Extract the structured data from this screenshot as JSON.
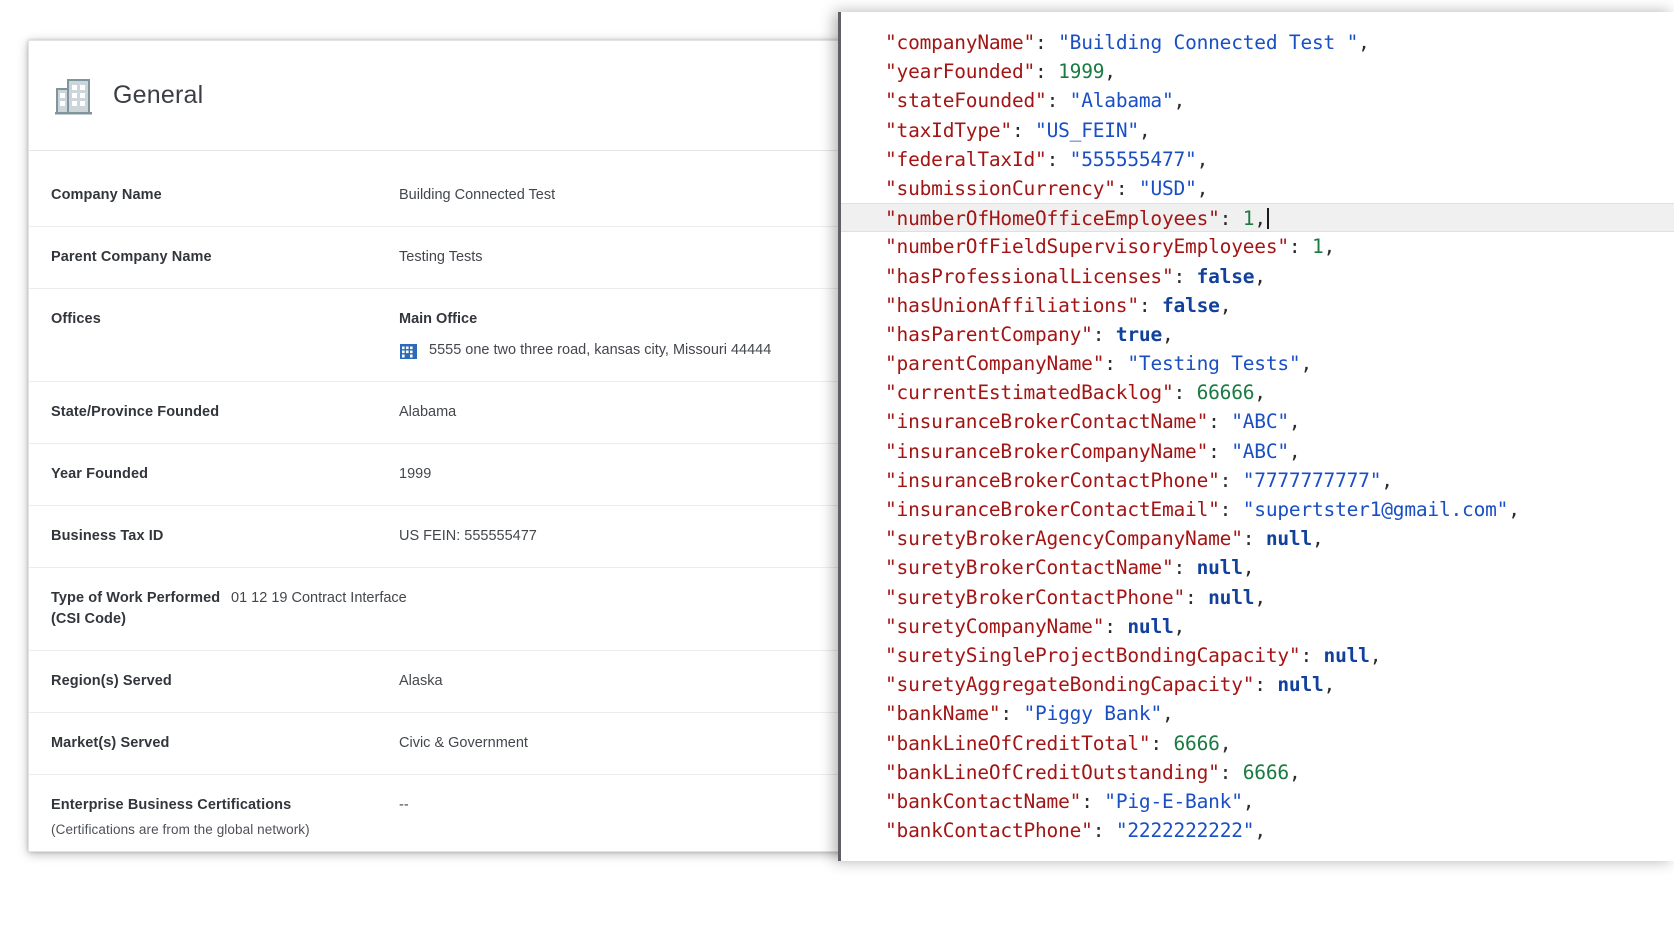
{
  "general_card": {
    "title": "General",
    "icon": "building-icon",
    "rows": [
      {
        "label": "Company Name",
        "sublabel": "",
        "value": "Building Connected Test",
        "type": "text"
      },
      {
        "label": "Parent Company Name",
        "sublabel": "",
        "value": "Testing Tests",
        "type": "text"
      },
      {
        "label": "Offices",
        "sublabel": "",
        "value": "",
        "type": "office",
        "office_name": "Main Office",
        "office_address": "5555 one two three road, kansas city, Missouri 44444",
        "office_icon": "office-building-icon"
      },
      {
        "label": "State/Province Founded",
        "sublabel": "",
        "value": "Alabama",
        "type": "text"
      },
      {
        "label": "Year Founded",
        "sublabel": "",
        "value": "1999",
        "type": "text"
      },
      {
        "label": "Business Tax ID",
        "sublabel": "",
        "value": "US FEIN: 555555477",
        "type": "text"
      },
      {
        "label": "Type of Work Performed (CSI Code)",
        "sublabel": "",
        "value": "01 12 19 Contract Interface",
        "type": "text"
      },
      {
        "label": "Region(s) Served",
        "sublabel": "",
        "value": "Alaska",
        "type": "text"
      },
      {
        "label": "Market(s) Served",
        "sublabel": "",
        "value": "Civic & Government",
        "type": "text"
      },
      {
        "label": "Enterprise Business Certifications",
        "sublabel": "(Certifications are from the global network)",
        "value": "--",
        "type": "text"
      }
    ]
  },
  "json_panel": {
    "active_line_index": 6,
    "lines": [
      {
        "key": "companyName",
        "value": "Building Connected Test ",
        "vtype": "string",
        "trail": ","
      },
      {
        "key": "yearFounded",
        "value": "1999",
        "vtype": "number",
        "trail": ","
      },
      {
        "key": "stateFounded",
        "value": "Alabama",
        "vtype": "string",
        "trail": ","
      },
      {
        "key": "taxIdType",
        "value": "US_FEIN",
        "vtype": "string",
        "trail": ","
      },
      {
        "key": "federalTaxId",
        "value": "555555477",
        "vtype": "string",
        "trail": ","
      },
      {
        "key": "submissionCurrency",
        "value": "USD",
        "vtype": "string",
        "trail": ","
      },
      {
        "key": "numberOfHomeOfficeEmployees",
        "value": "1",
        "vtype": "number",
        "trail": ","
      },
      {
        "key": "numberOfFieldSupervisoryEmployees",
        "value": "1",
        "vtype": "number",
        "trail": ","
      },
      {
        "key": "hasProfessionalLicenses",
        "value": "false",
        "vtype": "literal",
        "trail": ","
      },
      {
        "key": "hasUnionAffiliations",
        "value": "false",
        "vtype": "literal",
        "trail": ","
      },
      {
        "key": "hasParentCompany",
        "value": "true",
        "vtype": "literal",
        "trail": ","
      },
      {
        "key": "parentCompanyName",
        "value": "Testing Tests",
        "vtype": "string",
        "trail": ","
      },
      {
        "key": "currentEstimatedBacklog",
        "value": "66666",
        "vtype": "number",
        "trail": ","
      },
      {
        "key": "insuranceBrokerContactName",
        "value": "ABC",
        "vtype": "string",
        "trail": ","
      },
      {
        "key": "insuranceBrokerCompanyName",
        "value": "ABC",
        "vtype": "string",
        "trail": ","
      },
      {
        "key": "insuranceBrokerContactPhone",
        "value": "7777777777",
        "vtype": "string",
        "trail": ","
      },
      {
        "key": "insuranceBrokerContactEmail",
        "value": "supertster1@gmail.com",
        "vtype": "string",
        "trail": ","
      },
      {
        "key": "suretyBrokerAgencyCompanyName",
        "value": "null",
        "vtype": "literal",
        "trail": ","
      },
      {
        "key": "suretyBrokerContactName",
        "value": "null",
        "vtype": "literal",
        "trail": ","
      },
      {
        "key": "suretyBrokerContactPhone",
        "value": "null",
        "vtype": "literal",
        "trail": ","
      },
      {
        "key": "suretyCompanyName",
        "value": "null",
        "vtype": "literal",
        "trail": ","
      },
      {
        "key": "suretySingleProjectBondingCapacity",
        "value": "null",
        "vtype": "literal",
        "trail": ","
      },
      {
        "key": "suretyAggregateBondingCapacity",
        "value": "null",
        "vtype": "literal",
        "trail": ","
      },
      {
        "key": "bankName",
        "value": "Piggy Bank",
        "vtype": "string",
        "trail": ","
      },
      {
        "key": "bankLineOfCreditTotal",
        "value": "6666",
        "vtype": "number",
        "trail": ","
      },
      {
        "key": "bankLineOfCreditOutstanding",
        "value": "6666",
        "vtype": "number",
        "trail": ","
      },
      {
        "key": "bankContactName",
        "value": "Pig-E-Bank",
        "vtype": "string",
        "trail": ","
      },
      {
        "key": "bankContactPhone",
        "value": "2222222222",
        "vtype": "string",
        "trail": ","
      }
    ]
  },
  "colors": {
    "json_key": "#a31515",
    "json_string": "#1a4fc4",
    "json_number": "#1a7a42",
    "json_literal": "#11419c",
    "active_line_bg": "#f0f0f0",
    "card_border": "#e3e3e3",
    "label_text": "#32363c",
    "value_text": "#43474d",
    "building_icon": "#7f949c",
    "office_icon": "#2b6cb8"
  }
}
